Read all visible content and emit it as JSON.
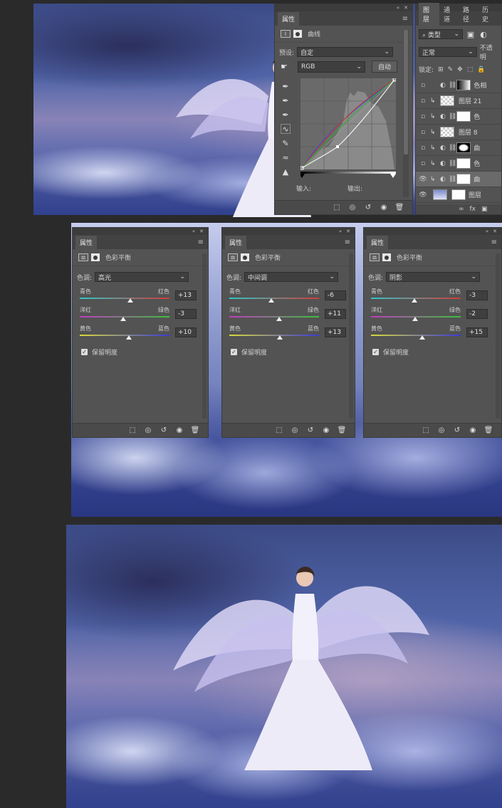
{
  "curves_panel": {
    "tab": "属性",
    "header_title": "曲线",
    "preset_label": "预设:",
    "preset_value": "自定",
    "channel": "RGB",
    "auto_button": "自动",
    "input_label": "输入:",
    "output_label": "输出:"
  },
  "layers_panel": {
    "tabs": [
      "图层",
      "通道",
      "路径",
      "历史"
    ],
    "kind_filter": "类型",
    "blend_mode": "正常",
    "opacity_label": "不透明",
    "lock_label": "锁定:",
    "layers": [
      {
        "name": "色相",
        "visible": false,
        "kind": "hue"
      },
      {
        "name": "图层 21",
        "visible": false,
        "kind": "pixel"
      },
      {
        "name": "色",
        "visible": false,
        "kind": "adjust"
      },
      {
        "name": "图层 8",
        "visible": false,
        "kind": "pixel"
      },
      {
        "name": "曲",
        "visible": false,
        "kind": "adjust-black"
      },
      {
        "name": "色",
        "visible": false,
        "kind": "adjust"
      },
      {
        "name": "曲",
        "visible": true,
        "kind": "adjust-selected"
      },
      {
        "name": "图层",
        "visible": true,
        "kind": "smart"
      }
    ]
  },
  "color_balance_panels": [
    {
      "tab": "属性",
      "title": "色彩平衡",
      "tone_label": "色调:",
      "tone": "高光",
      "sliders": [
        {
          "left": "青色",
          "right": "红色",
          "value": "+13",
          "pos": 13
        },
        {
          "left": "洋红",
          "right": "绿色",
          "value": "-3",
          "pos": -3
        },
        {
          "left": "黄色",
          "right": "蓝色",
          "value": "+10",
          "pos": 10
        }
      ],
      "preserve_label": "保留明度"
    },
    {
      "tab": "属性",
      "title": "色彩平衡",
      "tone_label": "色调:",
      "tone": "中间调",
      "sliders": [
        {
          "left": "青色",
          "right": "红色",
          "value": "-6",
          "pos": -6
        },
        {
          "left": "洋红",
          "right": "绿色",
          "value": "+11",
          "pos": 11
        },
        {
          "left": "黄色",
          "right": "蓝色",
          "value": "+13",
          "pos": 13
        }
      ],
      "preserve_label": "保留明度"
    },
    {
      "tab": "属性",
      "title": "色彩平衡",
      "tone_label": "色调:",
      "tone": "阴影",
      "sliders": [
        {
          "left": "青色",
          "right": "红色",
          "value": "-3",
          "pos": -3
        },
        {
          "left": "洋红",
          "right": "绿色",
          "value": "-2",
          "pos": -2
        },
        {
          "left": "黄色",
          "right": "蓝色",
          "value": "+15",
          "pos": 15
        }
      ],
      "preserve_label": "保留明度"
    }
  ],
  "colors": {
    "panel_bg": "#535353",
    "dark_bg": "#2a2a2a",
    "cyan_red": [
      "#2fc7c7",
      "#d43a3a"
    ],
    "magenta_green": [
      "#c03cc0",
      "#3cc03c"
    ],
    "yellow_blue": [
      "#d8d83a",
      "#3a3ad8"
    ]
  }
}
